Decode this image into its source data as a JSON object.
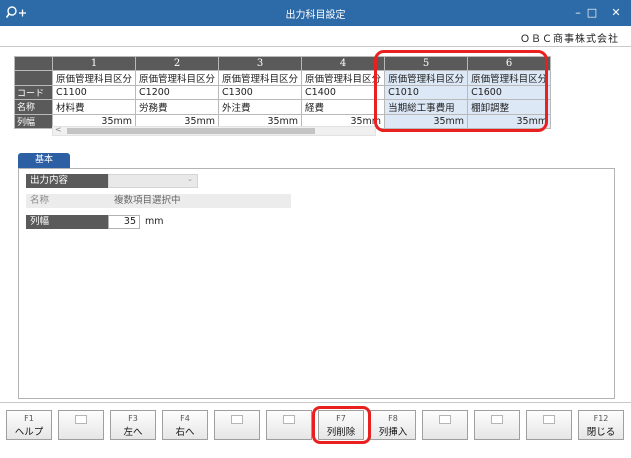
{
  "window": {
    "title": "出力科目設定",
    "minimize": "–",
    "maximize": "□",
    "close": "✕"
  },
  "company": "ＯＢＣ商事株式会社",
  "grid": {
    "columns": [
      "1",
      "2",
      "3",
      "4",
      "5",
      "6"
    ],
    "rows": [
      {
        "label": "",
        "values": [
          "原価管理科目区分",
          "原価管理科目区分",
          "原価管理科目区分",
          "原価管理科目区分",
          "原価管理科目区分",
          "原価管理科目区分"
        ]
      },
      {
        "label": "コード",
        "values": [
          "C1100",
          "C1200",
          "C1300",
          "C1400",
          "C1010",
          "C1600"
        ]
      },
      {
        "label": "名称",
        "values": [
          "材料費",
          "労務費",
          "外注費",
          "経費",
          "当期総工事費用",
          "棚卸調整"
        ]
      },
      {
        "label": "列幅",
        "values": [
          "35mm",
          "35mm",
          "35mm",
          "35mm",
          "35mm",
          "35mm"
        ]
      }
    ],
    "scroll_left": "<"
  },
  "tab": {
    "label": "基本"
  },
  "form": {
    "output_label": "出力内容",
    "output_value": "",
    "name_label": "名称",
    "name_value": "複数項目選択中",
    "width_label": "列幅",
    "width_value": "35",
    "width_unit": "mm"
  },
  "fkeys": [
    {
      "key": "F1",
      "label": "ヘルプ"
    },
    {
      "key": "",
      "label": ""
    },
    {
      "key": "F3",
      "label": "左へ"
    },
    {
      "key": "F4",
      "label": "右へ"
    },
    {
      "key": "",
      "label": ""
    },
    {
      "key": "",
      "label": ""
    },
    {
      "key": "F7",
      "label": "列削除"
    },
    {
      "key": "F8",
      "label": "列挿入"
    },
    {
      "key": "",
      "label": ""
    },
    {
      "key": "",
      "label": ""
    },
    {
      "key": "",
      "label": ""
    },
    {
      "key": "F12",
      "label": "閉じる"
    }
  ]
}
